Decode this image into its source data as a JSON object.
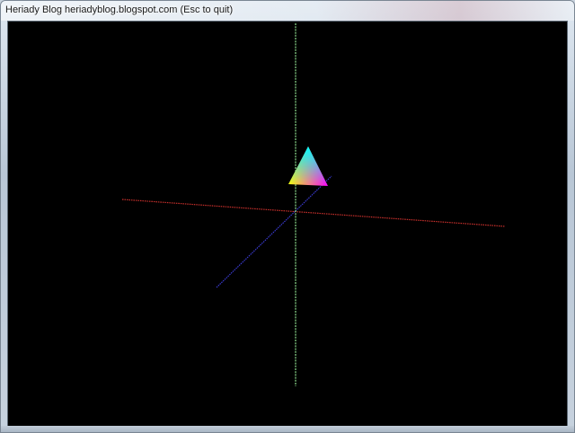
{
  "window": {
    "title": "Heriady Blog heriadyblog.blogspot.com (Esc to quit)"
  },
  "scene": {
    "background_color": "#000000",
    "axes": {
      "x_axis_color": "#c8302c",
      "y_axis_color": "#8fe08f",
      "z_axis_color": "#3a3ad0"
    },
    "triangle": {
      "vertex_colors": [
        "#00ffff",
        "#ffff00",
        "#ff00ff"
      ]
    }
  }
}
